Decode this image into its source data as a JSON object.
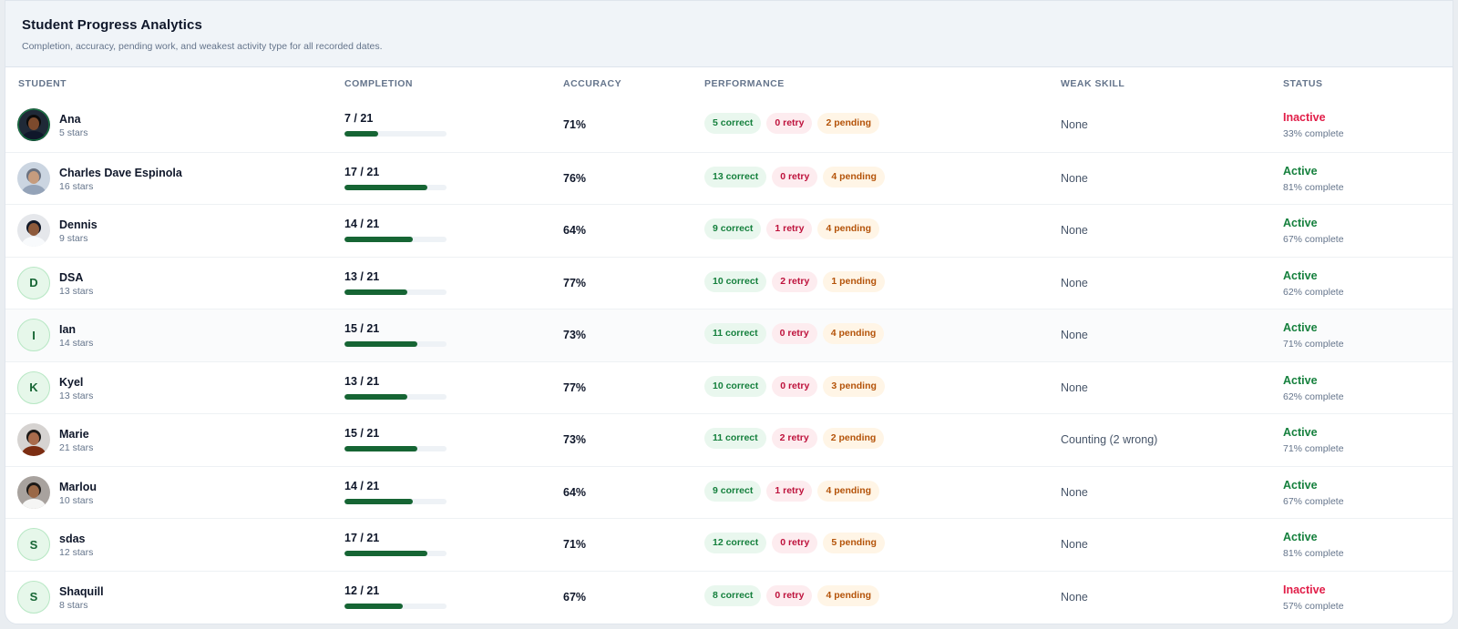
{
  "header": {
    "title": "Student Progress Analytics",
    "subtitle": "Completion, accuracy, pending work, and weakest activity type for all recorded dates."
  },
  "columns": {
    "student": "STUDENT",
    "completion": "COMPLETION",
    "accuracy": "ACCURACY",
    "performance": "PERFORMANCE",
    "weak_skill": "WEAK SKILL",
    "status": "STATUS"
  },
  "colors": {
    "accent": "#166534",
    "active": "#15803d",
    "inactive": "#e11d48",
    "pending": "#b45309"
  },
  "students": [
    {
      "avatar": "photo",
      "initial": "",
      "name": "Ana",
      "stars": "5 stars",
      "completion": "7 / 21",
      "completion_fraction": 0.333,
      "accuracy": "71%",
      "correct": "5 correct",
      "retry": "0 retry",
      "pending": "2 pending",
      "weak_skill": "None",
      "status": "Inactive",
      "status_type": "inactive",
      "status_detail": "33% complete"
    },
    {
      "avatar": "photo",
      "initial": "",
      "name": "Charles Dave Espinola",
      "stars": "16 stars",
      "completion": "17 / 21",
      "completion_fraction": 0.81,
      "accuracy": "76%",
      "correct": "13 correct",
      "retry": "0 retry",
      "pending": "4 pending",
      "weak_skill": "None",
      "status": "Active",
      "status_type": "active",
      "status_detail": "81% complete"
    },
    {
      "avatar": "photo",
      "initial": "",
      "name": "Dennis",
      "stars": "9 stars",
      "completion": "14 / 21",
      "completion_fraction": 0.667,
      "accuracy": "64%",
      "correct": "9 correct",
      "retry": "1 retry",
      "pending": "4 pending",
      "weak_skill": "None",
      "status": "Active",
      "status_type": "active",
      "status_detail": "67% complete"
    },
    {
      "avatar": "initial",
      "initial": "D",
      "name": "DSA",
      "stars": "13 stars",
      "completion": "13 / 21",
      "completion_fraction": 0.619,
      "accuracy": "77%",
      "correct": "10 correct",
      "retry": "2 retry",
      "pending": "1 pending",
      "weak_skill": "None",
      "status": "Active",
      "status_type": "active",
      "status_detail": "62% complete"
    },
    {
      "avatar": "initial",
      "initial": "I",
      "name": "Ian",
      "stars": "14 stars",
      "completion": "15 / 21",
      "completion_fraction": 0.714,
      "accuracy": "73%",
      "correct": "11 correct",
      "retry": "0 retry",
      "pending": "4 pending",
      "weak_skill": "None",
      "status": "Active",
      "status_type": "active",
      "status_detail": "71% complete"
    },
    {
      "avatar": "initial",
      "initial": "K",
      "name": "Kyel",
      "stars": "13 stars",
      "completion": "13 / 21",
      "completion_fraction": 0.619,
      "accuracy": "77%",
      "correct": "10 correct",
      "retry": "0 retry",
      "pending": "3 pending",
      "weak_skill": "None",
      "status": "Active",
      "status_type": "active",
      "status_detail": "62% complete"
    },
    {
      "avatar": "photo",
      "initial": "",
      "name": "Marie",
      "stars": "21 stars",
      "completion": "15 / 21",
      "completion_fraction": 0.714,
      "accuracy": "73%",
      "correct": "11 correct",
      "retry": "2 retry",
      "pending": "2 pending",
      "weak_skill": "Counting (2 wrong)",
      "status": "Active",
      "status_type": "active",
      "status_detail": "71% complete"
    },
    {
      "avatar": "photo",
      "initial": "",
      "name": "Marlou",
      "stars": "10 stars",
      "completion": "14 / 21",
      "completion_fraction": 0.667,
      "accuracy": "64%",
      "correct": "9 correct",
      "retry": "1 retry",
      "pending": "4 pending",
      "weak_skill": "None",
      "status": "Active",
      "status_type": "active",
      "status_detail": "67% complete"
    },
    {
      "avatar": "initial",
      "initial": "S",
      "name": "sdas",
      "stars": "12 stars",
      "completion": "17 / 21",
      "completion_fraction": 0.81,
      "accuracy": "71%",
      "correct": "12 correct",
      "retry": "0 retry",
      "pending": "5 pending",
      "weak_skill": "None",
      "status": "Active",
      "status_type": "active",
      "status_detail": "81% complete"
    },
    {
      "avatar": "initial",
      "initial": "S",
      "name": "Shaquill",
      "stars": "8 stars",
      "completion": "12 / 21",
      "completion_fraction": 0.571,
      "accuracy": "67%",
      "correct": "8 correct",
      "retry": "0 retry",
      "pending": "4 pending",
      "weak_skill": "None",
      "status": "Inactive",
      "status_type": "inactive",
      "status_detail": "57% complete"
    }
  ]
}
